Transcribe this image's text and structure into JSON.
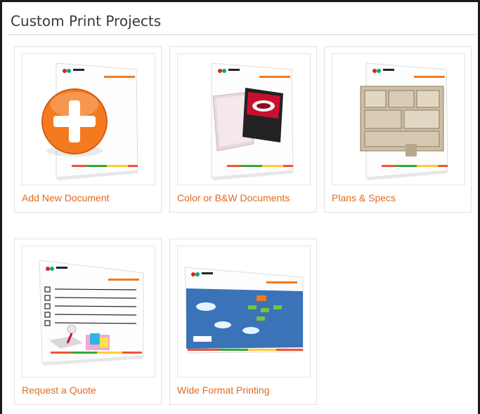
{
  "page": {
    "title": "Custom Print Projects"
  },
  "projects": [
    {
      "label": "Add New Document",
      "icon": "add-document-icon"
    },
    {
      "label": "Color or B&W Documents",
      "icon": "color-documents-icon"
    },
    {
      "label": "Plans & Specs",
      "icon": "floor-plan-icon"
    },
    {
      "label": "Request a Quote",
      "icon": "quote-checklist-icon"
    },
    {
      "label": "Wide Format Printing",
      "icon": "wide-format-banner-icon"
    }
  ],
  "colors": {
    "accent": "#e06b1d",
    "plus_orange": "#f47a20",
    "banner_blue": "#3a73b8"
  }
}
